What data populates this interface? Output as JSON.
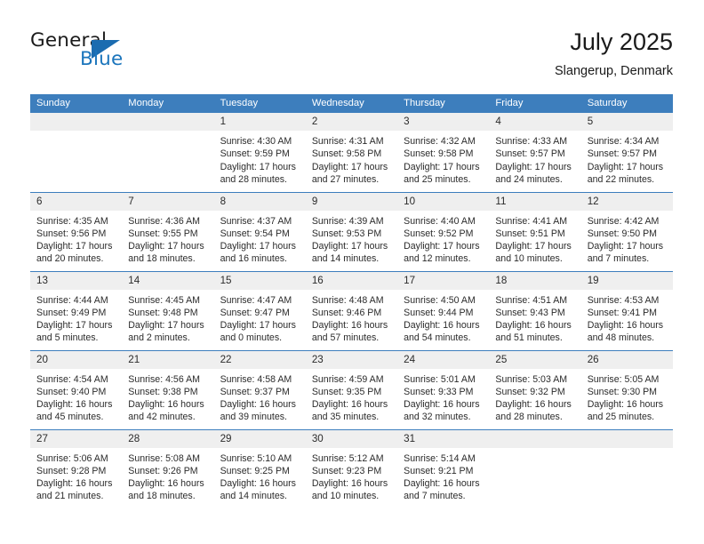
{
  "brand": {
    "logo_text_top": "General",
    "logo_text_bottom": "Blue",
    "accent_color": "#1b75bc",
    "triangle_color": "#1b6cb0"
  },
  "header": {
    "title": "July 2025",
    "subtitle": "Slangerup, Denmark"
  },
  "calendar": {
    "header_color": "#3d7ebd",
    "daynum_band_color": "#efefef",
    "weekdays": [
      "Sunday",
      "Monday",
      "Tuesday",
      "Wednesday",
      "Thursday",
      "Friday",
      "Saturday"
    ],
    "weeks": [
      [
        {
          "day": "",
          "empty": true,
          "sunrise": "",
          "sunset": "",
          "daylight_line1": "",
          "daylight_line2": ""
        },
        {
          "day": "",
          "empty": true,
          "sunrise": "",
          "sunset": "",
          "daylight_line1": "",
          "daylight_line2": ""
        },
        {
          "day": "1",
          "sunrise": "Sunrise: 4:30 AM",
          "sunset": "Sunset: 9:59 PM",
          "daylight_line1": "Daylight: 17 hours",
          "daylight_line2": "and 28 minutes."
        },
        {
          "day": "2",
          "sunrise": "Sunrise: 4:31 AM",
          "sunset": "Sunset: 9:58 PM",
          "daylight_line1": "Daylight: 17 hours",
          "daylight_line2": "and 27 minutes."
        },
        {
          "day": "3",
          "sunrise": "Sunrise: 4:32 AM",
          "sunset": "Sunset: 9:58 PM",
          "daylight_line1": "Daylight: 17 hours",
          "daylight_line2": "and 25 minutes."
        },
        {
          "day": "4",
          "sunrise": "Sunrise: 4:33 AM",
          "sunset": "Sunset: 9:57 PM",
          "daylight_line1": "Daylight: 17 hours",
          "daylight_line2": "and 24 minutes."
        },
        {
          "day": "5",
          "sunrise": "Sunrise: 4:34 AM",
          "sunset": "Sunset: 9:57 PM",
          "daylight_line1": "Daylight: 17 hours",
          "daylight_line2": "and 22 minutes."
        }
      ],
      [
        {
          "day": "6",
          "sunrise": "Sunrise: 4:35 AM",
          "sunset": "Sunset: 9:56 PM",
          "daylight_line1": "Daylight: 17 hours",
          "daylight_line2": "and 20 minutes."
        },
        {
          "day": "7",
          "sunrise": "Sunrise: 4:36 AM",
          "sunset": "Sunset: 9:55 PM",
          "daylight_line1": "Daylight: 17 hours",
          "daylight_line2": "and 18 minutes."
        },
        {
          "day": "8",
          "sunrise": "Sunrise: 4:37 AM",
          "sunset": "Sunset: 9:54 PM",
          "daylight_line1": "Daylight: 17 hours",
          "daylight_line2": "and 16 minutes."
        },
        {
          "day": "9",
          "sunrise": "Sunrise: 4:39 AM",
          "sunset": "Sunset: 9:53 PM",
          "daylight_line1": "Daylight: 17 hours",
          "daylight_line2": "and 14 minutes."
        },
        {
          "day": "10",
          "sunrise": "Sunrise: 4:40 AM",
          "sunset": "Sunset: 9:52 PM",
          "daylight_line1": "Daylight: 17 hours",
          "daylight_line2": "and 12 minutes."
        },
        {
          "day": "11",
          "sunrise": "Sunrise: 4:41 AM",
          "sunset": "Sunset: 9:51 PM",
          "daylight_line1": "Daylight: 17 hours",
          "daylight_line2": "and 10 minutes."
        },
        {
          "day": "12",
          "sunrise": "Sunrise: 4:42 AM",
          "sunset": "Sunset: 9:50 PM",
          "daylight_line1": "Daylight: 17 hours",
          "daylight_line2": "and 7 minutes."
        }
      ],
      [
        {
          "day": "13",
          "sunrise": "Sunrise: 4:44 AM",
          "sunset": "Sunset: 9:49 PM",
          "daylight_line1": "Daylight: 17 hours",
          "daylight_line2": "and 5 minutes."
        },
        {
          "day": "14",
          "sunrise": "Sunrise: 4:45 AM",
          "sunset": "Sunset: 9:48 PM",
          "daylight_line1": "Daylight: 17 hours",
          "daylight_line2": "and 2 minutes."
        },
        {
          "day": "15",
          "sunrise": "Sunrise: 4:47 AM",
          "sunset": "Sunset: 9:47 PM",
          "daylight_line1": "Daylight: 17 hours",
          "daylight_line2": "and 0 minutes."
        },
        {
          "day": "16",
          "sunrise": "Sunrise: 4:48 AM",
          "sunset": "Sunset: 9:46 PM",
          "daylight_line1": "Daylight: 16 hours",
          "daylight_line2": "and 57 minutes."
        },
        {
          "day": "17",
          "sunrise": "Sunrise: 4:50 AM",
          "sunset": "Sunset: 9:44 PM",
          "daylight_line1": "Daylight: 16 hours",
          "daylight_line2": "and 54 minutes."
        },
        {
          "day": "18",
          "sunrise": "Sunrise: 4:51 AM",
          "sunset": "Sunset: 9:43 PM",
          "daylight_line1": "Daylight: 16 hours",
          "daylight_line2": "and 51 minutes."
        },
        {
          "day": "19",
          "sunrise": "Sunrise: 4:53 AM",
          "sunset": "Sunset: 9:41 PM",
          "daylight_line1": "Daylight: 16 hours",
          "daylight_line2": "and 48 minutes."
        }
      ],
      [
        {
          "day": "20",
          "sunrise": "Sunrise: 4:54 AM",
          "sunset": "Sunset: 9:40 PM",
          "daylight_line1": "Daylight: 16 hours",
          "daylight_line2": "and 45 minutes."
        },
        {
          "day": "21",
          "sunrise": "Sunrise: 4:56 AM",
          "sunset": "Sunset: 9:38 PM",
          "daylight_line1": "Daylight: 16 hours",
          "daylight_line2": "and 42 minutes."
        },
        {
          "day": "22",
          "sunrise": "Sunrise: 4:58 AM",
          "sunset": "Sunset: 9:37 PM",
          "daylight_line1": "Daylight: 16 hours",
          "daylight_line2": "and 39 minutes."
        },
        {
          "day": "23",
          "sunrise": "Sunrise: 4:59 AM",
          "sunset": "Sunset: 9:35 PM",
          "daylight_line1": "Daylight: 16 hours",
          "daylight_line2": "and 35 minutes."
        },
        {
          "day": "24",
          "sunrise": "Sunrise: 5:01 AM",
          "sunset": "Sunset: 9:33 PM",
          "daylight_line1": "Daylight: 16 hours",
          "daylight_line2": "and 32 minutes."
        },
        {
          "day": "25",
          "sunrise": "Sunrise: 5:03 AM",
          "sunset": "Sunset: 9:32 PM",
          "daylight_line1": "Daylight: 16 hours",
          "daylight_line2": "and 28 minutes."
        },
        {
          "day": "26",
          "sunrise": "Sunrise: 5:05 AM",
          "sunset": "Sunset: 9:30 PM",
          "daylight_line1": "Daylight: 16 hours",
          "daylight_line2": "and 25 minutes."
        }
      ],
      [
        {
          "day": "27",
          "sunrise": "Sunrise: 5:06 AM",
          "sunset": "Sunset: 9:28 PM",
          "daylight_line1": "Daylight: 16 hours",
          "daylight_line2": "and 21 minutes."
        },
        {
          "day": "28",
          "sunrise": "Sunrise: 5:08 AM",
          "sunset": "Sunset: 9:26 PM",
          "daylight_line1": "Daylight: 16 hours",
          "daylight_line2": "and 18 minutes."
        },
        {
          "day": "29",
          "sunrise": "Sunrise: 5:10 AM",
          "sunset": "Sunset: 9:25 PM",
          "daylight_line1": "Daylight: 16 hours",
          "daylight_line2": "and 14 minutes."
        },
        {
          "day": "30",
          "sunrise": "Sunrise: 5:12 AM",
          "sunset": "Sunset: 9:23 PM",
          "daylight_line1": "Daylight: 16 hours",
          "daylight_line2": "and 10 minutes."
        },
        {
          "day": "31",
          "sunrise": "Sunrise: 5:14 AM",
          "sunset": "Sunset: 9:21 PM",
          "daylight_line1": "Daylight: 16 hours",
          "daylight_line2": "and 7 minutes."
        },
        {
          "day": "",
          "empty": true,
          "sunrise": "",
          "sunset": "",
          "daylight_line1": "",
          "daylight_line2": ""
        },
        {
          "day": "",
          "empty": true,
          "sunrise": "",
          "sunset": "",
          "daylight_line1": "",
          "daylight_line2": ""
        }
      ]
    ]
  }
}
